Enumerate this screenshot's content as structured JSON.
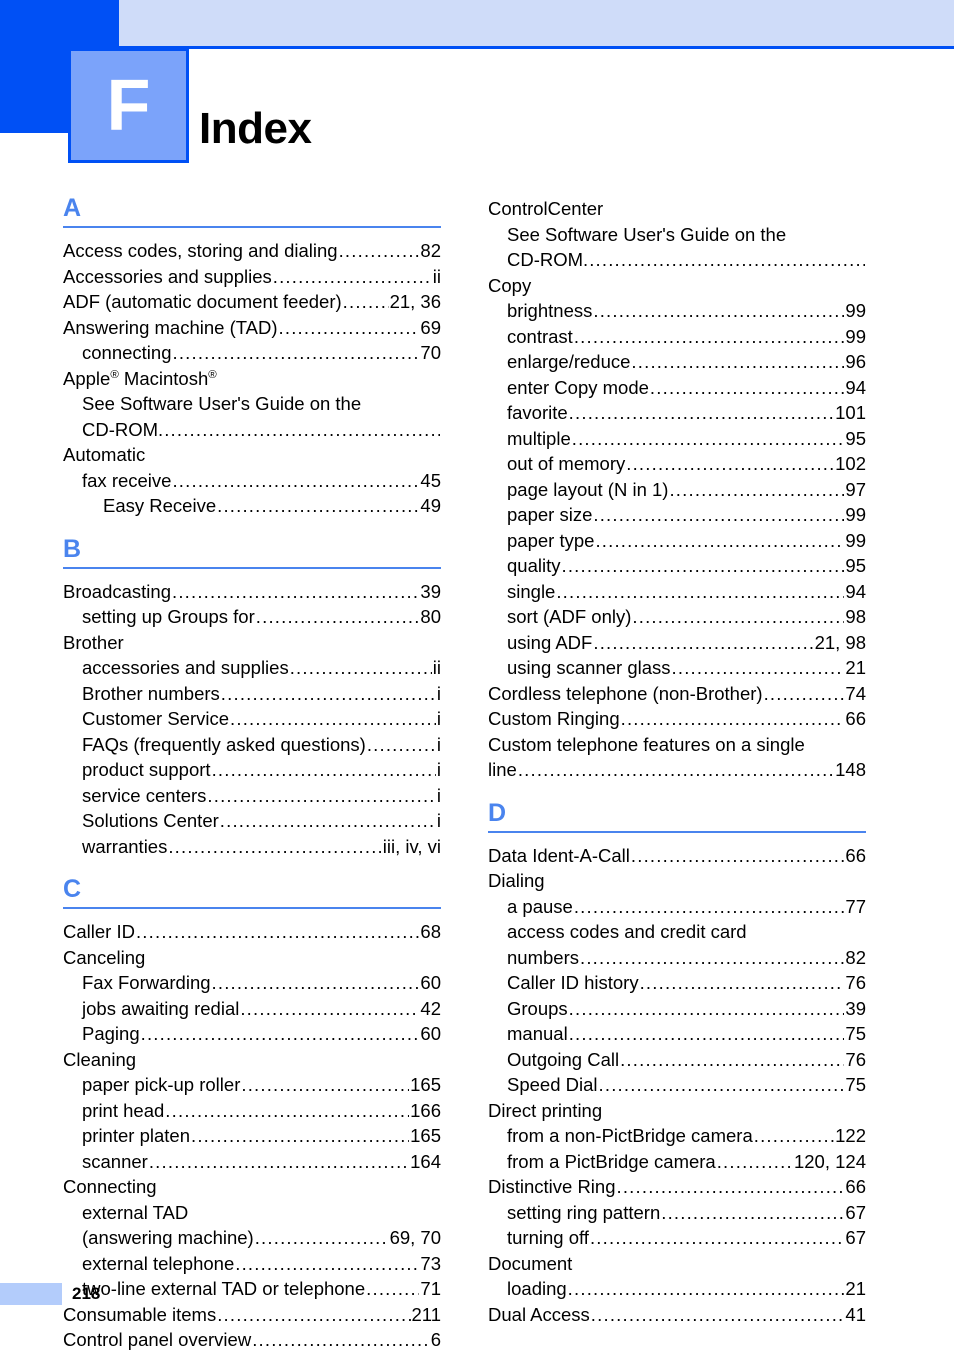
{
  "header": {
    "chapter_letter": "F",
    "title": "Index",
    "colors": {
      "dark_blue": "#0050f5",
      "light_band": "#cfdcf9",
      "tab_fill": "#7ba3fa",
      "section_blue": "#4a84ee",
      "footer_bar": "#b3ccfb"
    }
  },
  "footer": {
    "page_number": "218"
  },
  "columns": {
    "left": [
      {
        "letter": "A",
        "entries": [
          {
            "level": 0,
            "text": "Access codes, storing and dialing",
            "page": "82"
          },
          {
            "level": 0,
            "text": "Accessories and supplies",
            "page": "ii"
          },
          {
            "level": 0,
            "text": "ADF (automatic document feeder)",
            "page": "21, 36"
          },
          {
            "level": 0,
            "text": "Answering machine (TAD)",
            "page": "69"
          },
          {
            "level": 1,
            "text": "connecting",
            "page": "70"
          },
          {
            "level": 0,
            "text": "Apple® Macintosh®",
            "page": "",
            "html": "Apple<sup>®</sup> Macintosh<sup>®</sup>",
            "leader": false
          },
          {
            "level": 1,
            "text": "See Software User's Guide on the",
            "page": "",
            "leader": false
          },
          {
            "level": 1,
            "text": "CD-ROM.",
            "page": ""
          },
          {
            "level": 0,
            "text": "Automatic",
            "page": "",
            "leader": false
          },
          {
            "level": 1,
            "text": "fax receive",
            "page": "45"
          },
          {
            "level": 2,
            "text": "Easy Receive",
            "page": "49"
          }
        ]
      },
      {
        "letter": "B",
        "entries": [
          {
            "level": 0,
            "text": "Broadcasting",
            "page": "39"
          },
          {
            "level": 1,
            "text": "setting up Groups for",
            "page": "80"
          },
          {
            "level": 0,
            "text": "Brother",
            "page": "",
            "leader": false
          },
          {
            "level": 1,
            "text": "accessories and supplies",
            "page": "ii"
          },
          {
            "level": 1,
            "text": "Brother numbers",
            "page": "i"
          },
          {
            "level": 1,
            "text": "Customer Service",
            "page": "i"
          },
          {
            "level": 1,
            "text": "FAQs (frequently asked questions)",
            "page": "i"
          },
          {
            "level": 1,
            "text": "product support",
            "page": "i"
          },
          {
            "level": 1,
            "text": "service centers",
            "page": "i"
          },
          {
            "level": 1,
            "text": "Solutions Center",
            "page": "i"
          },
          {
            "level": 1,
            "text": "warranties",
            "page": "iii, iv, vi"
          }
        ]
      },
      {
        "letter": "C",
        "entries": [
          {
            "level": 0,
            "text": "Caller ID",
            "page": "68"
          },
          {
            "level": 0,
            "text": "Canceling",
            "page": "",
            "leader": false
          },
          {
            "level": 1,
            "text": "Fax Forwarding",
            "page": "60"
          },
          {
            "level": 1,
            "text": "jobs awaiting redial",
            "page": "42"
          },
          {
            "level": 1,
            "text": "Paging",
            "page": "60"
          },
          {
            "level": 0,
            "text": "Cleaning",
            "page": "",
            "leader": false
          },
          {
            "level": 1,
            "text": "paper pick-up roller",
            "page": "165"
          },
          {
            "level": 1,
            "text": "print head",
            "page": "166"
          },
          {
            "level": 1,
            "text": "printer platen",
            "page": "165"
          },
          {
            "level": 1,
            "text": "scanner",
            "page": "164"
          },
          {
            "level": 0,
            "text": "Connecting",
            "page": "",
            "leader": false
          },
          {
            "level": 1,
            "text": "external TAD",
            "page": "",
            "leader": false
          },
          {
            "level": 1,
            "text": "(answering machine)",
            "page": "69, 70"
          },
          {
            "level": 1,
            "text": "external telephone",
            "page": "73"
          },
          {
            "level": 1,
            "text": "two-line external TAD or telephone",
            "page": "71"
          },
          {
            "level": 0,
            "text": "Consumable items",
            "page": "211"
          },
          {
            "level": 0,
            "text": "Control panel overview",
            "page": "6"
          }
        ]
      }
    ],
    "right": [
      {
        "letter": "",
        "entries": [
          {
            "level": 0,
            "text": "ControlCenter",
            "page": "",
            "leader": false
          },
          {
            "level": 1,
            "text": "See Software User's Guide on the",
            "page": "",
            "leader": false
          },
          {
            "level": 1,
            "text": "CD-ROM.",
            "page": ""
          },
          {
            "level": 0,
            "text": "Copy",
            "page": "",
            "leader": false
          },
          {
            "level": 1,
            "text": "brightness",
            "page": "99"
          },
          {
            "level": 1,
            "text": "contrast",
            "page": "99"
          },
          {
            "level": 1,
            "text": "enlarge/reduce",
            "page": "96"
          },
          {
            "level": 1,
            "text": "enter Copy mode",
            "page": "94"
          },
          {
            "level": 1,
            "text": "favorite",
            "page": "101"
          },
          {
            "level": 1,
            "text": "multiple",
            "page": "95"
          },
          {
            "level": 1,
            "text": "out of memory",
            "page": "102"
          },
          {
            "level": 1,
            "text": "page layout (N in 1)",
            "page": "97"
          },
          {
            "level": 1,
            "text": "paper size",
            "page": "99"
          },
          {
            "level": 1,
            "text": "paper type",
            "page": "99"
          },
          {
            "level": 1,
            "text": "quality",
            "page": "95"
          },
          {
            "level": 1,
            "text": "single",
            "page": "94"
          },
          {
            "level": 1,
            "text": "sort (ADF only)",
            "page": "98"
          },
          {
            "level": 1,
            "text": "using ADF",
            "page": "21, 98"
          },
          {
            "level": 1,
            "text": "using scanner glass",
            "page": "21"
          },
          {
            "level": 0,
            "text": "Cordless telephone (non-Brother)",
            "page": "74"
          },
          {
            "level": 0,
            "text": "Custom Ringing",
            "page": "66"
          },
          {
            "level": 0,
            "text": "Custom telephone features on a single",
            "page": "",
            "leader": false
          },
          {
            "level": 0,
            "text": "line",
            "page": "148"
          }
        ]
      },
      {
        "letter": "D",
        "entries": [
          {
            "level": 0,
            "text": "Data Ident-A-Call",
            "page": "66"
          },
          {
            "level": 0,
            "text": "Dialing",
            "page": "",
            "leader": false
          },
          {
            "level": 1,
            "text": "a pause",
            "page": "77"
          },
          {
            "level": 1,
            "text": "access codes and credit card",
            "page": "",
            "leader": false
          },
          {
            "level": 1,
            "text": "numbers",
            "page": "82"
          },
          {
            "level": 1,
            "text": "Caller ID history",
            "page": "76"
          },
          {
            "level": 1,
            "text": "Groups",
            "page": "39"
          },
          {
            "level": 1,
            "text": "manual",
            "page": "75"
          },
          {
            "level": 1,
            "text": "Outgoing Call",
            "page": "76"
          },
          {
            "level": 1,
            "text": "Speed Dial",
            "page": "75"
          },
          {
            "level": 0,
            "text": "Direct printing",
            "page": "",
            "leader": false
          },
          {
            "level": 1,
            "text": "from a non-PictBridge camera",
            "page": "122"
          },
          {
            "level": 1,
            "text": "from a PictBridge camera",
            "page": "120, 124"
          },
          {
            "level": 0,
            "text": "Distinctive Ring",
            "page": "66"
          },
          {
            "level": 1,
            "text": "setting ring pattern",
            "page": "67"
          },
          {
            "level": 1,
            "text": "turning off",
            "page": "67"
          },
          {
            "level": 0,
            "text": "Document",
            "page": "",
            "leader": false
          },
          {
            "level": 1,
            "text": "loading",
            "page": "21"
          },
          {
            "level": 0,
            "text": "Dual Access",
            "page": "41"
          }
        ]
      }
    ]
  }
}
